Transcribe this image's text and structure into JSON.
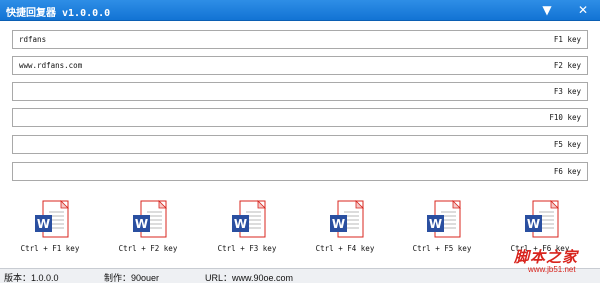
{
  "window": {
    "title": "快捷回复器 v1.0.0.0",
    "controls": {
      "menu_icon": "dropdown-arrow-icon",
      "close_icon": "close-icon"
    }
  },
  "hotkeys": [
    {
      "reply": "rdfans",
      "key": "F1 key"
    },
    {
      "reply": "www.rdfans.com",
      "key": "F2 key"
    },
    {
      "reply": "",
      "key": "F3 key"
    },
    {
      "reply": "",
      "key": "F10 key"
    },
    {
      "reply": "",
      "key": "F5 key"
    },
    {
      "reply": "",
      "key": "F6 key"
    }
  ],
  "shortcuts": [
    {
      "label": "Ctrl + F1 key",
      "icon": "word-document-icon"
    },
    {
      "label": "Ctrl + F2 key",
      "icon": "word-document-icon"
    },
    {
      "label": "Ctrl + F3 key",
      "icon": "word-document-icon"
    },
    {
      "label": "Ctrl + F4 key",
      "icon": "word-document-icon"
    },
    {
      "label": "Ctrl + F5 key",
      "icon": "word-document-icon"
    },
    {
      "label": "Ctrl + F6 key",
      "icon": "word-document-icon"
    }
  ],
  "status": {
    "version": "版本：1.0.0.0",
    "author": "制作：90ouer",
    "url": "URL：www.90oe.com"
  },
  "watermark": {
    "main": "脚本之家",
    "sub": "www.jb51.net"
  },
  "colors": {
    "titlebar": "#1a7fdd",
    "doc_red": "#d8241d",
    "word_blue": "#2a4fa0"
  }
}
